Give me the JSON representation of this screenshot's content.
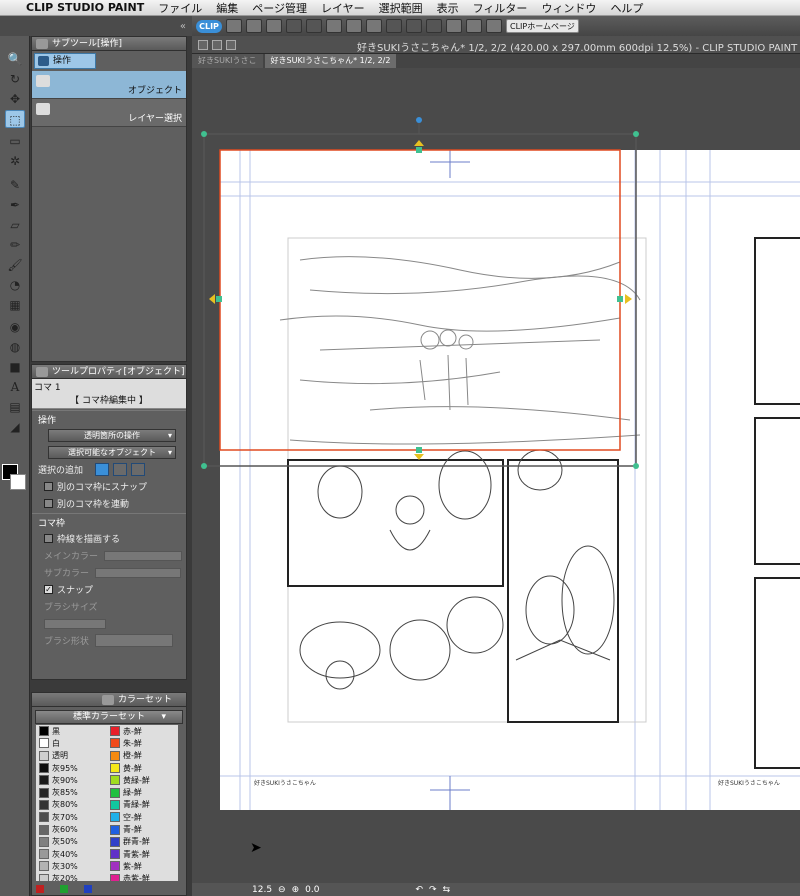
{
  "menubar": {
    "app_name": "CLIP STUDIO PAINT",
    "items": [
      "ファイル",
      "編集",
      "ページ管理",
      "レイヤー",
      "選択範囲",
      "表示",
      "フィルター",
      "ウィンドウ",
      "ヘルプ"
    ]
  },
  "toolbar": {
    "logo": "CLIP",
    "home_button": "CLIPホームページ"
  },
  "subtool": {
    "title": "サブツール[操作]",
    "tab_label": "操作",
    "items": [
      {
        "label": "オブジェクト",
        "selected": true,
        "icon": "object-select-icon"
      },
      {
        "label": "レイヤー選択",
        "selected": false,
        "icon": "layer-select-icon"
      }
    ]
  },
  "tool_property": {
    "title": "ツールプロパティ[オブジェクト]",
    "koma_name": "コマ 1",
    "koma_status": "【 コマ枠編集中 】",
    "section_operation": "操作",
    "transparent_op": "透明箇所の操作",
    "selectable_object": "選択可能なオブジェクト",
    "add_selection": "選択の追加",
    "snap_other_frame": "別のコマ枠にスナップ",
    "link_other_frame": "別のコマ枠を連動",
    "section_frame": "コマ枠",
    "draw_border": "枠線を描画する",
    "main_color": "メインカラー",
    "sub_color": "サブカラー",
    "snap": "スナップ",
    "brush_size": "ブラシサイズ",
    "brush_shape": "ブラシ形状"
  },
  "colorset": {
    "title": "カラーセット",
    "set_name": "標準カラーセット",
    "left": [
      {
        "name": "黒",
        "color": "#000000"
      },
      {
        "name": "白",
        "color": "#ffffff"
      },
      {
        "name": "透明",
        "color": "#cfcfcf"
      },
      {
        "name": "灰95%",
        "color": "#0d0d0d"
      },
      {
        "name": "灰90%",
        "color": "#1a1a1a"
      },
      {
        "name": "灰85%",
        "color": "#262626"
      },
      {
        "name": "灰80%",
        "color": "#333333"
      },
      {
        "name": "灰70%",
        "color": "#4d4d4d"
      },
      {
        "name": "灰60%",
        "color": "#666666"
      },
      {
        "name": "灰50%",
        "color": "#808080"
      },
      {
        "name": "灰40%",
        "color": "#999999"
      },
      {
        "name": "灰30%",
        "color": "#b3b3b3"
      },
      {
        "name": "灰20%",
        "color": "#cccccc"
      }
    ],
    "right": [
      {
        "name": "赤-鮮",
        "color": "#e8202a"
      },
      {
        "name": "朱-鮮",
        "color": "#f04a1a"
      },
      {
        "name": "橙-鮮",
        "color": "#f58a10"
      },
      {
        "name": "黄-鮮",
        "color": "#f5e81a"
      },
      {
        "name": "黄緑-鮮",
        "color": "#a0dc20"
      },
      {
        "name": "緑-鮮",
        "color": "#20c040"
      },
      {
        "name": "青緑-鮮",
        "color": "#10c8a0"
      },
      {
        "name": "空-鮮",
        "color": "#20b0e8"
      },
      {
        "name": "青-鮮",
        "color": "#2060e0"
      },
      {
        "name": "群青-鮮",
        "color": "#3040c8"
      },
      {
        "name": "青紫-鮮",
        "color": "#6030c8"
      },
      {
        "name": "紫-鮮",
        "color": "#a030c0"
      },
      {
        "name": "赤紫-鮮",
        "color": "#e02090"
      }
    ]
  },
  "document": {
    "title": "好きSUKIうさこちゃん* 1/2, 2/2 (420.00 x 297.00mm 600dpi 12.5%) - CLIP STUDIO PAINT",
    "tabs": [
      "好きSUKIうさこ",
      "好きSUKIうさこちゃん* 1/2, 2/2"
    ],
    "footer_left": "好きSUKIうさこちゃん",
    "footer_right": "好きSUKIうさこちゃん"
  },
  "status": {
    "zoom": "12.5",
    "angle": "0.0"
  }
}
